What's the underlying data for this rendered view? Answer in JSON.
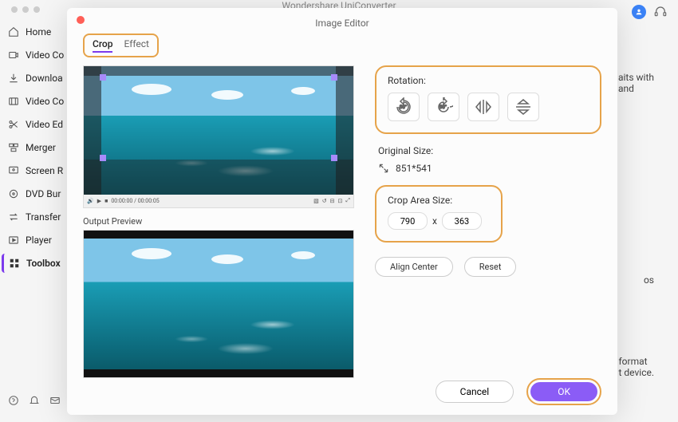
{
  "app": {
    "title": "Wondershare UniConverter"
  },
  "sidebar": {
    "items": [
      {
        "icon": "home",
        "label": "Home"
      },
      {
        "icon": "video",
        "label": "Video Co"
      },
      {
        "icon": "download",
        "label": "Downloa"
      },
      {
        "icon": "videoc",
        "label": "Video Co"
      },
      {
        "icon": "scissors",
        "label": "Video Ed"
      },
      {
        "icon": "merger",
        "label": "Merger"
      },
      {
        "icon": "screen",
        "label": "Screen R"
      },
      {
        "icon": "dvd",
        "label": "DVD Bur"
      },
      {
        "icon": "transfer",
        "label": "Transfer"
      },
      {
        "icon": "player",
        "label": "Player"
      },
      {
        "icon": "toolbox",
        "label": "Toolbox"
      }
    ]
  },
  "background_snippets": {
    "s1a": "aits with",
    "s1b": "and",
    "s2": "os",
    "s3a": "format",
    "s3b": "t device."
  },
  "modal": {
    "title": "Image Editor",
    "tabs": [
      {
        "label": "Crop"
      },
      {
        "label": "Effect"
      }
    ],
    "rotation": {
      "label": "Rotation:",
      "buttons": [
        {
          "name": "rotate-left-90",
          "glyph": "↺90°"
        },
        {
          "name": "rotate-right-90",
          "glyph": "90°↻"
        },
        {
          "name": "flip-horizontal",
          "glyph": "⇋"
        },
        {
          "name": "flip-vertical",
          "glyph": "⇌"
        }
      ]
    },
    "original_size": {
      "label": "Original Size:",
      "value": "851*541"
    },
    "crop_area": {
      "label": "Crop Area Size:",
      "width": "790",
      "sep": "x",
      "height": "363"
    },
    "align_center": "Align Center",
    "reset": "Reset",
    "output_preview": "Output Preview",
    "player_controls": {
      "time": "00:00:00 / 00:00:05"
    },
    "cancel": "Cancel",
    "ok": "OK"
  }
}
